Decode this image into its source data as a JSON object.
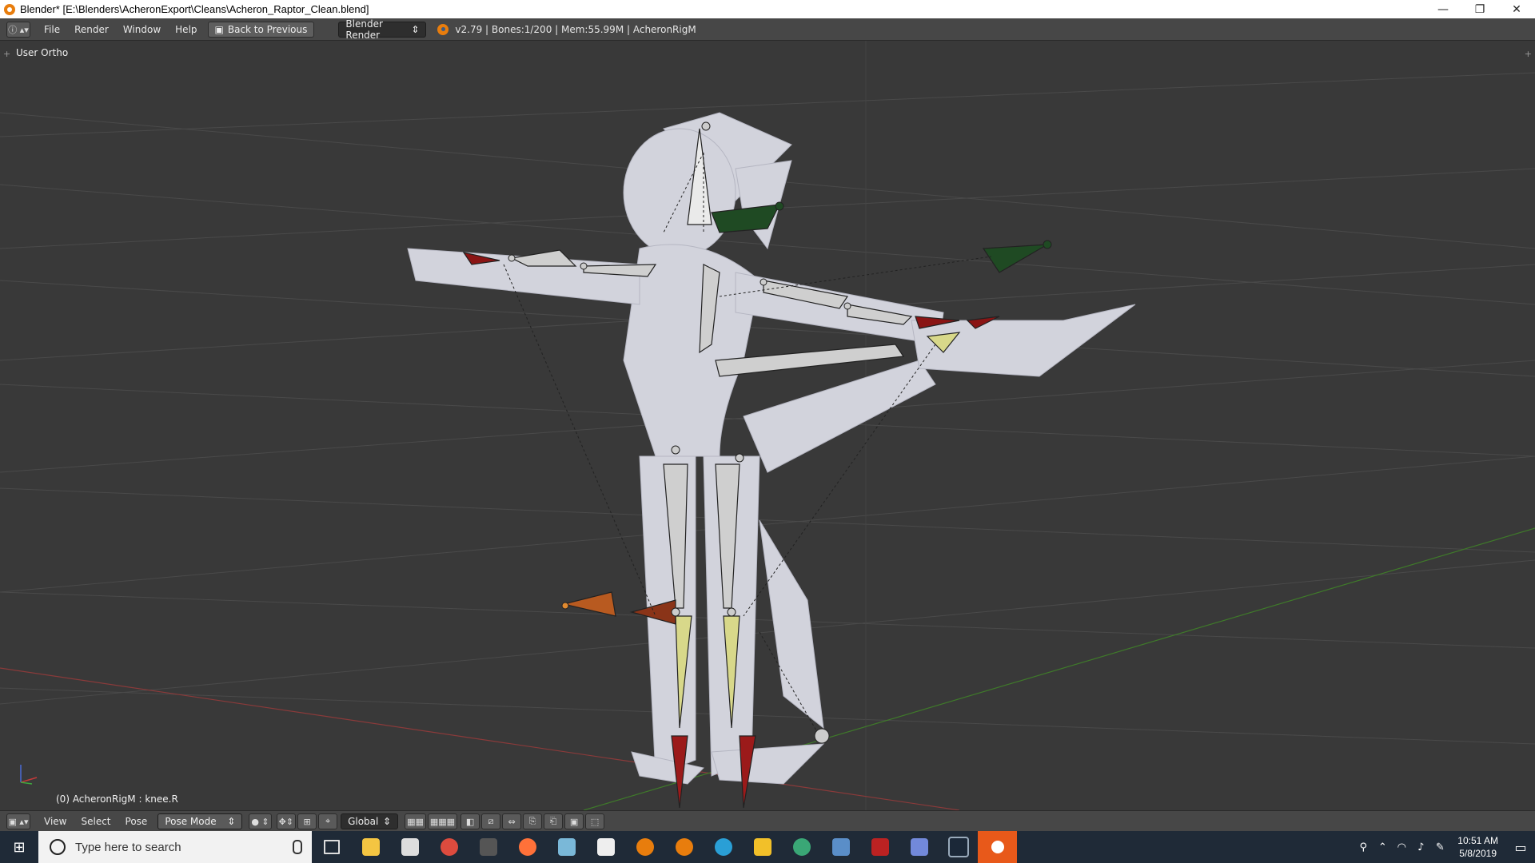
{
  "window": {
    "title": "Blender* [E:\\Blenders\\AcheronExport\\Cleans\\Acheron_Raptor_Clean.blend]",
    "controls": [
      "—",
      "❐",
      "✕"
    ]
  },
  "info_header": {
    "editor_type_icon": "info-icon",
    "menus": [
      "File",
      "Render",
      "Window",
      "Help"
    ],
    "back_button": "Back to Previous",
    "render_engine": "Blender Render",
    "status": "v2.79 | Bones:1/200 | Mem:55.99M | AcheronRigM"
  },
  "viewport": {
    "view_label": "User Ortho",
    "object_label": "(0) AcheronRigM : knee.R",
    "colors": {
      "background": "#393939",
      "grid": "#4a4a4a",
      "x_axis": "#8a3a3a",
      "y_axis": "#3f7a2a",
      "mesh": "#d4d4dc"
    }
  },
  "view_footer": {
    "menus": [
      "View",
      "Select",
      "Pose"
    ],
    "mode": "Pose Mode",
    "orientation": "Global"
  },
  "taskbar": {
    "search_placeholder": "Type here to search",
    "time": "10:51 AM",
    "date": "5/8/2019",
    "apps": [
      "task-view-icon",
      "file-explorer-icon",
      "mail-icon",
      "chrome-icon",
      "app-icon",
      "firefox-icon",
      "app-icon",
      "calculator-icon",
      "blender-icon",
      "blender-icon",
      "app-icon",
      "app-icon",
      "app-icon",
      "app-icon",
      "app-icon",
      "discord-icon",
      "steam-icon",
      "blender-active-icon"
    ]
  }
}
